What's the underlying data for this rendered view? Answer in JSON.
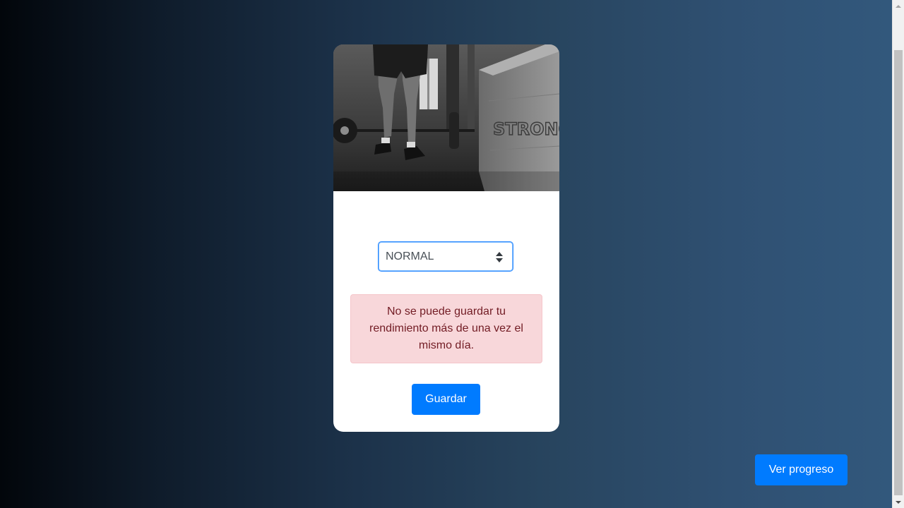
{
  "form": {
    "select_value": "NORMAL",
    "alert_message": "No se puede guardar tu rendimiento más de una vez el mismo día.",
    "save_label": "Guardar"
  },
  "footer": {
    "progress_label": "Ver progreso"
  },
  "image": {
    "box_text": "STRONG"
  },
  "colors": {
    "primary": "#007bff",
    "alert_bg": "#f8d7da",
    "alert_text": "#721c24"
  }
}
